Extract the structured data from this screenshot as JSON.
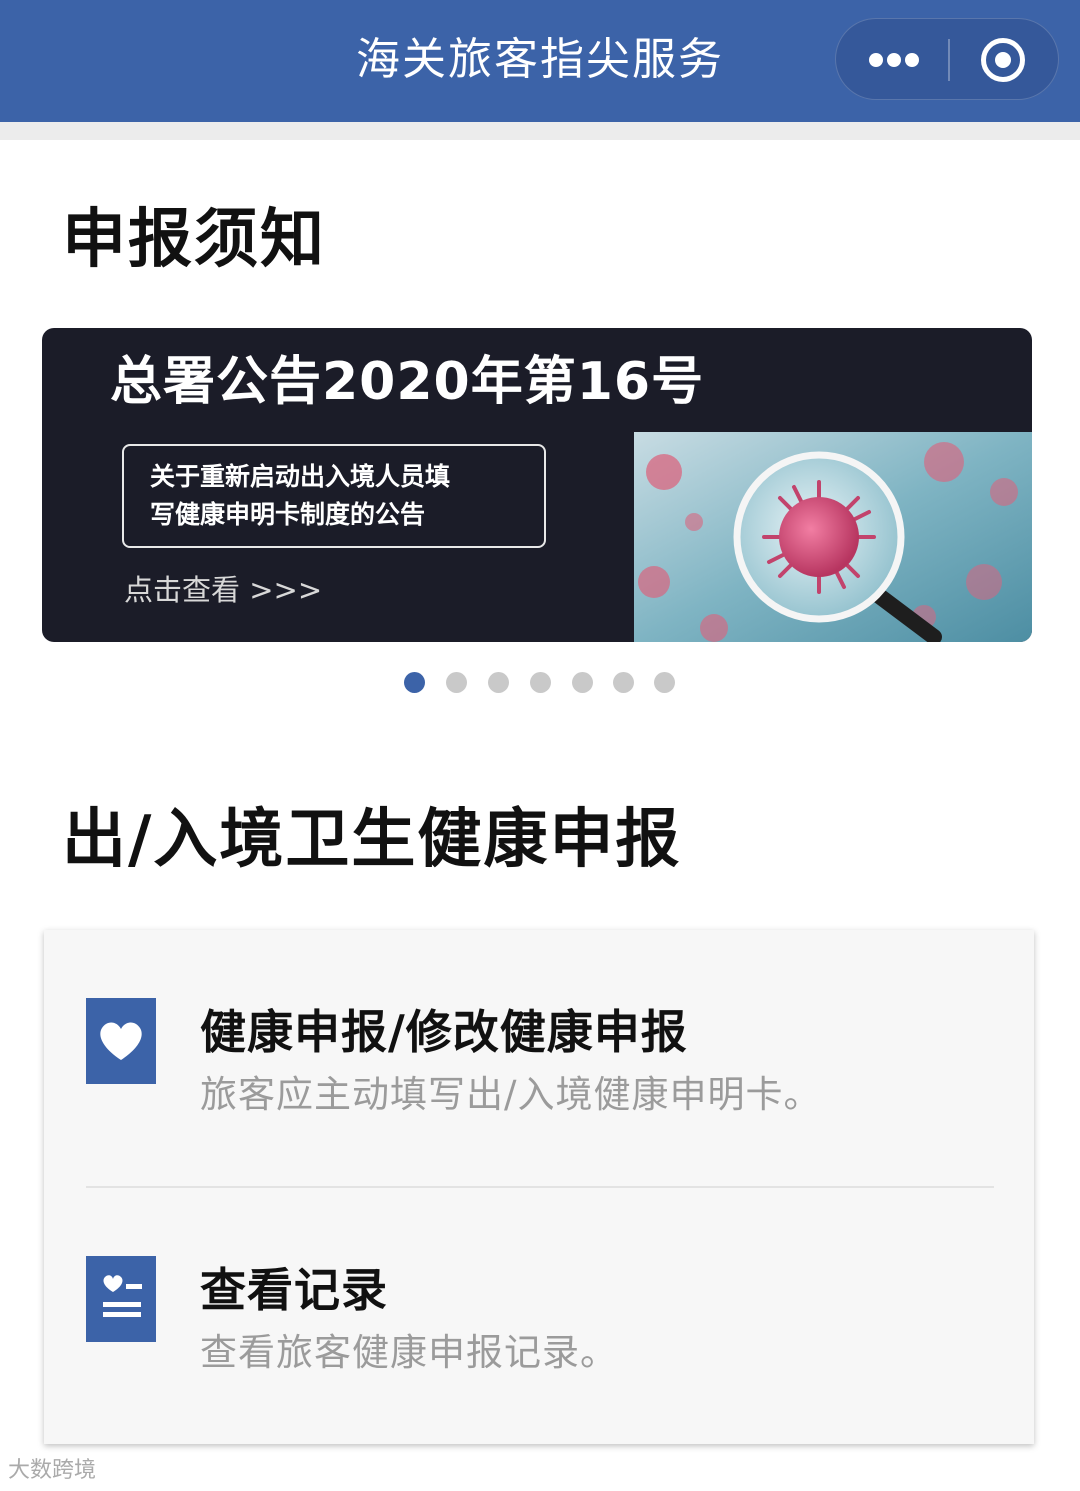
{
  "navbar": {
    "title": "海关旅客指尖服务"
  },
  "notice": {
    "section_title": "申报须知",
    "banner": {
      "headline": "总署公告2020年第16号",
      "box_line1": "关于重新启动出入境人员填",
      "box_line2": "写健康申明卡制度的公告",
      "link_text": "点击查看 >>>"
    },
    "carousel": {
      "total": 7,
      "active_index": 0
    }
  },
  "declaration": {
    "section_title": "出/入境卫生健康申报",
    "items": [
      {
        "icon": "heart-icon",
        "title": "健康申报/修改健康申报",
        "desc": "旅客应主动填写出/入境健康申明卡。"
      },
      {
        "icon": "record-list-icon",
        "title": "查看记录",
        "desc": "查看旅客健康申报记录。"
      }
    ]
  },
  "watermark": {
    "text": "大数跨境"
  },
  "colors": {
    "primary": "#3c63a8",
    "banner_bg": "#1b1c28"
  }
}
